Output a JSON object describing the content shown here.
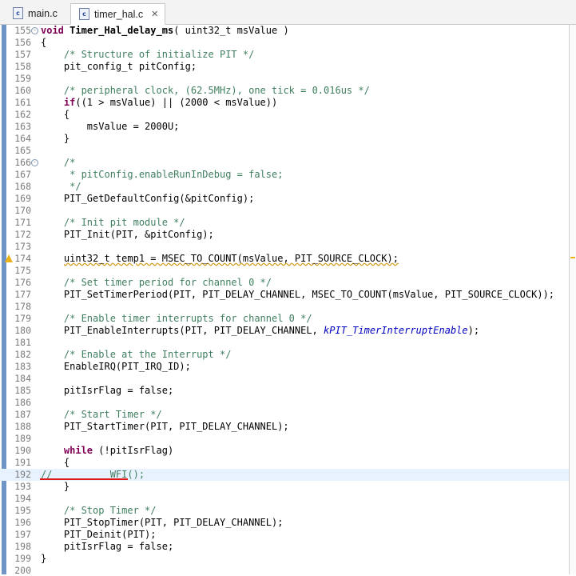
{
  "tabs": [
    {
      "label": "main.c",
      "icon": "c-file-icon",
      "active": false
    },
    {
      "label": "timer_hal.c",
      "icon": "c-file-icon",
      "active": true,
      "close": "✕"
    }
  ],
  "file_icon_letter": "c",
  "fold_symbol": "⊖",
  "lines": [
    {
      "n": "155",
      "html": "<span class=\"kw\">void</span> <b>Timer_Hal_delay_ms</b>( uint32_t msValue )",
      "fold": true
    },
    {
      "n": "156",
      "html": "{"
    },
    {
      "n": "157",
      "html": "    <span class=\"cm\">/* Structure of initialize PIT */</span>"
    },
    {
      "n": "158",
      "html": "    pit_config_t pitConfig;"
    },
    {
      "n": "159",
      "html": ""
    },
    {
      "n": "160",
      "html": "    <span class=\"cm\">/* peripheral clock, (62.5MHz), one tick = 0.016us */</span>"
    },
    {
      "n": "161",
      "html": "    <span class=\"kw\">if</span>((1 &gt; msValue) || (2000 &lt; msValue))"
    },
    {
      "n": "162",
      "html": "    {"
    },
    {
      "n": "163",
      "html": "        msValue = 2000U;"
    },
    {
      "n": "164",
      "html": "    }"
    },
    {
      "n": "165",
      "html": ""
    },
    {
      "n": "166",
      "html": "    <span class=\"cm\">/*</span>",
      "fold": true
    },
    {
      "n": "167",
      "html": "    <span class=\"cm\"> * pitConfig.enableRunInDebug = false;</span>"
    },
    {
      "n": "168",
      "html": "    <span class=\"cm\"> */</span>"
    },
    {
      "n": "169",
      "html": "    PIT_GetDefaultConfig(&amp;pitConfig);"
    },
    {
      "n": "170",
      "html": ""
    },
    {
      "n": "171",
      "html": "    <span class=\"cm\">/* Init pit module */</span>"
    },
    {
      "n": "172",
      "html": "    PIT_Init(PIT, &amp;pitConfig);"
    },
    {
      "n": "173",
      "html": ""
    },
    {
      "n": "174",
      "html": "    <span class=\"sq\">uint32_t temp1 = MSEC_TO_COUNT(msValue, PIT_SOURCE_CLOCK);</span>",
      "warn": true
    },
    {
      "n": "175",
      "html": ""
    },
    {
      "n": "176",
      "html": "    <span class=\"cm\">/* Set timer period for channel 0 */</span>"
    },
    {
      "n": "177",
      "html": "    PIT_SetTimerPeriod(PIT, PIT_DELAY_CHANNEL, MSEC_TO_COUNT(msValue, PIT_SOURCE_CLOCK));"
    },
    {
      "n": "178",
      "html": ""
    },
    {
      "n": "179",
      "html": "    <span class=\"cm\">/* Enable timer interrupts for channel 0 */</span>"
    },
    {
      "n": "180",
      "html": "    PIT_EnableInterrupts(PIT, PIT_DELAY_CHANNEL, <span class=\"it\">kPIT_TimerInterruptEnable</span>);"
    },
    {
      "n": "181",
      "html": ""
    },
    {
      "n": "182",
      "html": "    <span class=\"cm\">/* Enable at the Interrupt */</span>"
    },
    {
      "n": "183",
      "html": "    EnableIRQ(PIT_IRQ_ID);"
    },
    {
      "n": "184",
      "html": ""
    },
    {
      "n": "185",
      "html": "    pitIsrFlag = false;"
    },
    {
      "n": "186",
      "html": ""
    },
    {
      "n": "187",
      "html": "    <span class=\"cm\">/* Start Timer */</span>"
    },
    {
      "n": "188",
      "html": "    PIT_StartTimer(PIT, PIT_DELAY_CHANNEL);"
    },
    {
      "n": "189",
      "html": ""
    },
    {
      "n": "190",
      "html": "    <span class=\"kw\">while</span> (!pitIsrFlag)"
    },
    {
      "n": "191",
      "html": "    {"
    },
    {
      "n": "192",
      "html": "<span class=\"cm\">//        __WFI();</span>",
      "highlight": true
    },
    {
      "n": "193",
      "html": "    }"
    },
    {
      "n": "194",
      "html": ""
    },
    {
      "n": "195",
      "html": "    <span class=\"cm\">/* Stop Timer */</span>"
    },
    {
      "n": "196",
      "html": "    PIT_StopTimer(PIT, PIT_DELAY_CHANNEL);"
    },
    {
      "n": "197",
      "html": "    PIT_Deinit(PIT);"
    },
    {
      "n": "198",
      "html": "    pitIsrFlag = false;"
    },
    {
      "n": "199",
      "html": "}"
    },
    {
      "n": "200",
      "html": ""
    }
  ],
  "colors": {
    "keyword": "#7f0055",
    "comment": "#3f7f5f",
    "enum": "#0000c0",
    "ruler": "#6f95c7",
    "highlight": "#e8f2fe",
    "annotation_underline": "#e01818"
  }
}
